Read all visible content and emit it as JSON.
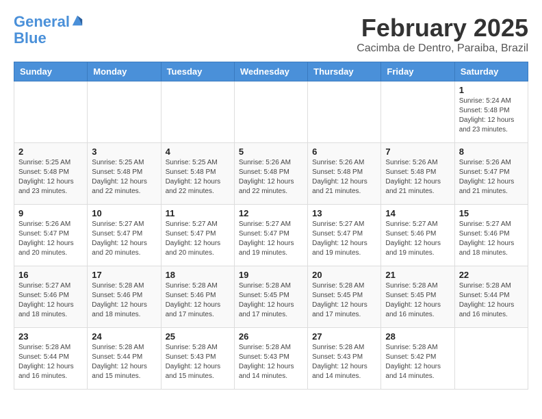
{
  "header": {
    "logo_line1": "General",
    "logo_line2": "Blue",
    "month_title": "February 2025",
    "location": "Cacimba de Dentro, Paraiba, Brazil"
  },
  "days_of_week": [
    "Sunday",
    "Monday",
    "Tuesday",
    "Wednesday",
    "Thursday",
    "Friday",
    "Saturday"
  ],
  "weeks": [
    [
      {
        "day": "",
        "info": ""
      },
      {
        "day": "",
        "info": ""
      },
      {
        "day": "",
        "info": ""
      },
      {
        "day": "",
        "info": ""
      },
      {
        "day": "",
        "info": ""
      },
      {
        "day": "",
        "info": ""
      },
      {
        "day": "1",
        "info": "Sunrise: 5:24 AM\nSunset: 5:48 PM\nDaylight: 12 hours and 23 minutes."
      }
    ],
    [
      {
        "day": "2",
        "info": "Sunrise: 5:25 AM\nSunset: 5:48 PM\nDaylight: 12 hours and 23 minutes."
      },
      {
        "day": "3",
        "info": "Sunrise: 5:25 AM\nSunset: 5:48 PM\nDaylight: 12 hours and 22 minutes."
      },
      {
        "day": "4",
        "info": "Sunrise: 5:25 AM\nSunset: 5:48 PM\nDaylight: 12 hours and 22 minutes."
      },
      {
        "day": "5",
        "info": "Sunrise: 5:26 AM\nSunset: 5:48 PM\nDaylight: 12 hours and 22 minutes."
      },
      {
        "day": "6",
        "info": "Sunrise: 5:26 AM\nSunset: 5:48 PM\nDaylight: 12 hours and 21 minutes."
      },
      {
        "day": "7",
        "info": "Sunrise: 5:26 AM\nSunset: 5:48 PM\nDaylight: 12 hours and 21 minutes."
      },
      {
        "day": "8",
        "info": "Sunrise: 5:26 AM\nSunset: 5:47 PM\nDaylight: 12 hours and 21 minutes."
      }
    ],
    [
      {
        "day": "9",
        "info": "Sunrise: 5:26 AM\nSunset: 5:47 PM\nDaylight: 12 hours and 20 minutes."
      },
      {
        "day": "10",
        "info": "Sunrise: 5:27 AM\nSunset: 5:47 PM\nDaylight: 12 hours and 20 minutes."
      },
      {
        "day": "11",
        "info": "Sunrise: 5:27 AM\nSunset: 5:47 PM\nDaylight: 12 hours and 20 minutes."
      },
      {
        "day": "12",
        "info": "Sunrise: 5:27 AM\nSunset: 5:47 PM\nDaylight: 12 hours and 19 minutes."
      },
      {
        "day": "13",
        "info": "Sunrise: 5:27 AM\nSunset: 5:47 PM\nDaylight: 12 hours and 19 minutes."
      },
      {
        "day": "14",
        "info": "Sunrise: 5:27 AM\nSunset: 5:46 PM\nDaylight: 12 hours and 19 minutes."
      },
      {
        "day": "15",
        "info": "Sunrise: 5:27 AM\nSunset: 5:46 PM\nDaylight: 12 hours and 18 minutes."
      }
    ],
    [
      {
        "day": "16",
        "info": "Sunrise: 5:27 AM\nSunset: 5:46 PM\nDaylight: 12 hours and 18 minutes."
      },
      {
        "day": "17",
        "info": "Sunrise: 5:28 AM\nSunset: 5:46 PM\nDaylight: 12 hours and 18 minutes."
      },
      {
        "day": "18",
        "info": "Sunrise: 5:28 AM\nSunset: 5:46 PM\nDaylight: 12 hours and 17 minutes."
      },
      {
        "day": "19",
        "info": "Sunrise: 5:28 AM\nSunset: 5:45 PM\nDaylight: 12 hours and 17 minutes."
      },
      {
        "day": "20",
        "info": "Sunrise: 5:28 AM\nSunset: 5:45 PM\nDaylight: 12 hours and 17 minutes."
      },
      {
        "day": "21",
        "info": "Sunrise: 5:28 AM\nSunset: 5:45 PM\nDaylight: 12 hours and 16 minutes."
      },
      {
        "day": "22",
        "info": "Sunrise: 5:28 AM\nSunset: 5:44 PM\nDaylight: 12 hours and 16 minutes."
      }
    ],
    [
      {
        "day": "23",
        "info": "Sunrise: 5:28 AM\nSunset: 5:44 PM\nDaylight: 12 hours and 16 minutes."
      },
      {
        "day": "24",
        "info": "Sunrise: 5:28 AM\nSunset: 5:44 PM\nDaylight: 12 hours and 15 minutes."
      },
      {
        "day": "25",
        "info": "Sunrise: 5:28 AM\nSunset: 5:43 PM\nDaylight: 12 hours and 15 minutes."
      },
      {
        "day": "26",
        "info": "Sunrise: 5:28 AM\nSunset: 5:43 PM\nDaylight: 12 hours and 14 minutes."
      },
      {
        "day": "27",
        "info": "Sunrise: 5:28 AM\nSunset: 5:43 PM\nDaylight: 12 hours and 14 minutes."
      },
      {
        "day": "28",
        "info": "Sunrise: 5:28 AM\nSunset: 5:42 PM\nDaylight: 12 hours and 14 minutes."
      },
      {
        "day": "",
        "info": ""
      }
    ]
  ]
}
